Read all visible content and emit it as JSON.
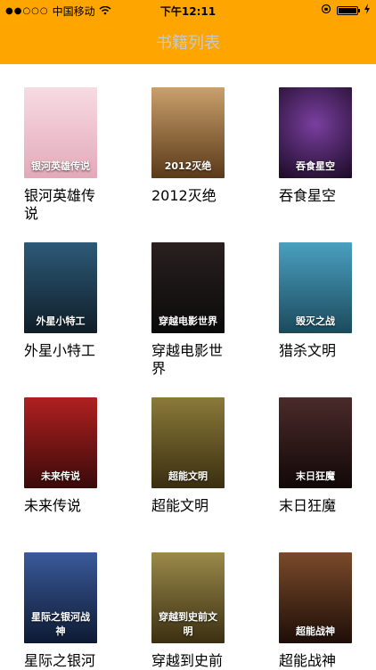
{
  "status": {
    "carrier": "中国移动",
    "time": "下午12:11"
  },
  "nav": {
    "title": "书籍列表"
  },
  "books": [
    {
      "title": "银河英雄传说",
      "cover_text": "银河英雄传说",
      "cover_bg": "#f2c7d2"
    },
    {
      "title": "2012灭绝",
      "cover_text": "2012灭绝",
      "cover_bg": "#8a5a2e"
    },
    {
      "title": "吞食星空",
      "cover_text": "吞食星空",
      "cover_bg": "#2a1536"
    },
    {
      "title": "外星小特工",
      "cover_text": "外星小特工",
      "cover_bg": "#1e3a4c"
    },
    {
      "title": "穿越电影世界",
      "cover_text": "穿越电影世界",
      "cover_bg": "#1a1a1a"
    },
    {
      "title": "猎杀文明",
      "cover_text": "毁灭之战",
      "cover_bg": "#1f6b88"
    },
    {
      "title": "未来传说",
      "cover_text": "未来传说",
      "cover_bg": "#7a1313"
    },
    {
      "title": "超能文明",
      "cover_text": "超能文明",
      "cover_bg": "#6a5a2c"
    },
    {
      "title": "末日狂魔",
      "cover_text": "末日狂魔",
      "cover_bg": "#2a1a1a"
    },
    {
      "title": "星际之银河",
      "cover_text": "星际之银河战神",
      "cover_bg": "#1c2f5c"
    },
    {
      "title": "穿越到史前",
      "cover_text": "穿越到史前文明",
      "cover_bg": "#6b5a2d"
    },
    {
      "title": "超能战神",
      "cover_text": "超能战神",
      "cover_bg": "#3b2418"
    }
  ]
}
